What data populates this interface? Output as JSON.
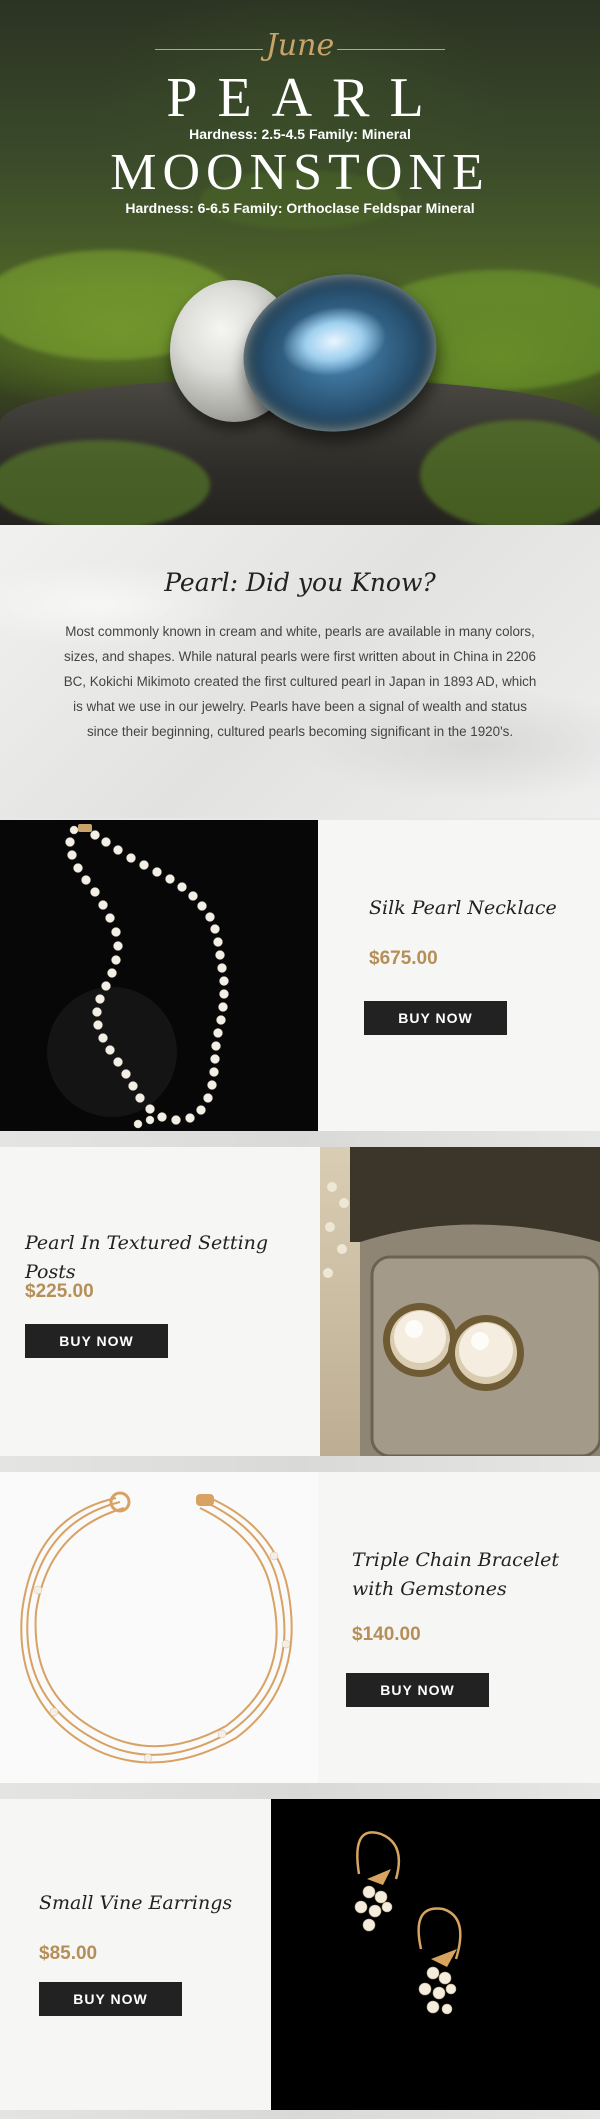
{
  "hero": {
    "month": "June",
    "stone1": "PEARL",
    "stone1_details": "Hardness: 2.5-4.5  Family: Mineral",
    "stone2": "MOONSTONE",
    "stone2_details": "Hardness: 6-6.5  Family: Orthoclase Feldspar Mineral"
  },
  "did_you_know": {
    "title": "Pearl: Did you Know?",
    "body": "Most commonly known in cream and white, pearls are available in many colors, sizes, and shapes. While natural pearls were first written about in China in 2206 BC, Kokichi Mikimoto created the first cultured pearl in Japan in 1893 AD, which is what we use in our jewelry. Pearls have been a signal of wealth and status since their beginning, cultured pearls becoming significant in the 1920's."
  },
  "products": [
    {
      "name": "Silk Pearl Necklace",
      "price": "$675.00",
      "button": "BUY NOW"
    },
    {
      "name": "Pearl In Textured Setting Posts",
      "price": "$225.00",
      "button": "BUY NOW"
    },
    {
      "name": "Triple Chain Bracelet with Gemstones",
      "price": "$140.00",
      "button": "BUY NOW"
    },
    {
      "name": "Small Vine Earrings",
      "price": "$85.00",
      "button": "BUY NOW"
    }
  ],
  "colors": {
    "accent_gold": "#b58f57",
    "button_bg": "#222222",
    "panel_bg": "#f6f6f5"
  }
}
